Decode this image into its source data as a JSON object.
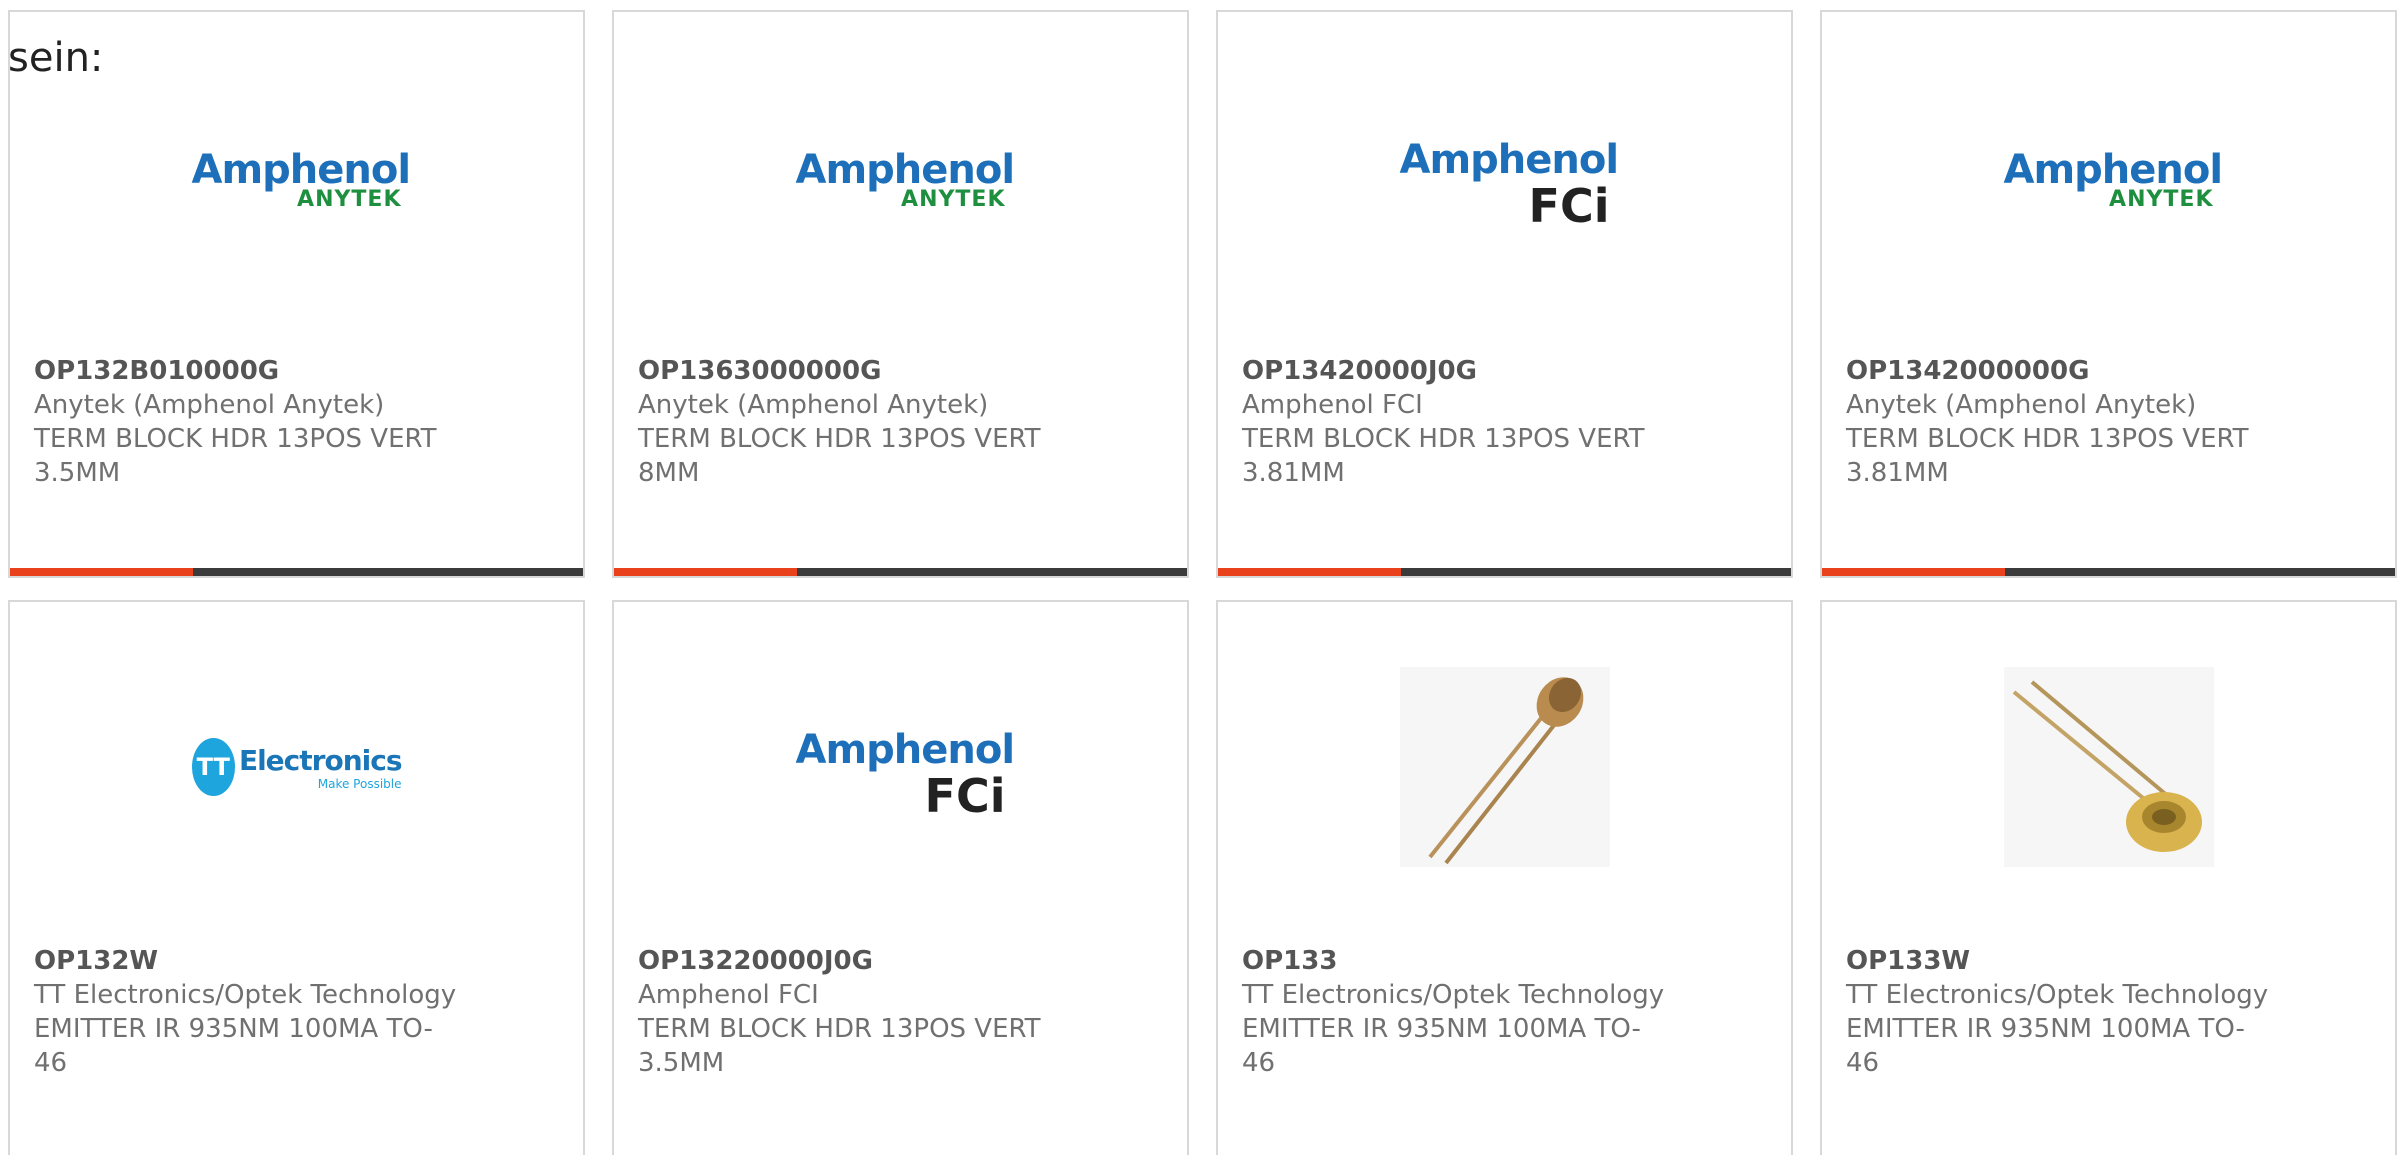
{
  "intro": {
    "text": "sein:"
  },
  "products": [
    {
      "part_number": "OP132B010000G",
      "manufacturer": "Anytek (Amphenol Anytek)",
      "description": "TERM BLOCK HDR 13POS VERT 3.5MM",
      "logo": {
        "type": "amphenol-anytek",
        "brand": "Amphenol",
        "sub": "ANYTEK"
      },
      "progress": 0.32
    },
    {
      "part_number": "OP1363000000G",
      "manufacturer": "Anytek (Amphenol Anytek)",
      "description": "TERM BLOCK HDR 13POS VERT 8MM",
      "logo": {
        "type": "amphenol-anytek",
        "brand": "Amphenol",
        "sub": "ANYTEK"
      },
      "progress": 0.32
    },
    {
      "part_number": "OP13420000J0G",
      "manufacturer": "Amphenol FCI",
      "description": "TERM BLOCK HDR 13POS VERT 3.81MM",
      "logo": {
        "type": "amphenol-fci",
        "brand": "Amphenol",
        "sub": "FCi"
      },
      "progress": 0.32
    },
    {
      "part_number": "OP1342000000G",
      "manufacturer": "Anytek (Amphenol Anytek)",
      "description": "TERM BLOCK HDR 13POS VERT 3.81MM",
      "logo": {
        "type": "amphenol-anytek",
        "brand": "Amphenol",
        "sub": "ANYTEK"
      },
      "progress": 0.32
    },
    {
      "part_number": "OP132W",
      "manufacturer": "TT Electronics/Optek Technology",
      "description": "EMITTER IR 935NM 100MA TO-46",
      "logo": {
        "type": "tt-electronics",
        "brand": "Electronics",
        "sub": "Make Possible",
        "mark": "TT"
      }
    },
    {
      "part_number": "OP13220000J0G",
      "manufacturer": "Amphenol FCI",
      "description": "TERM BLOCK HDR 13POS VERT 3.5MM",
      "logo": {
        "type": "amphenol-fci",
        "brand": "Amphenol",
        "sub": "FCi"
      }
    },
    {
      "part_number": "OP133",
      "manufacturer": "TT Electronics/Optek Technology",
      "description": "EMITTER IR 935NM 100MA TO-46",
      "logo": {
        "type": "photo-led-side"
      }
    },
    {
      "part_number": "OP133W",
      "manufacturer": "TT Electronics/Optek Technology",
      "description": "EMITTER IR 935NM 100MA TO-46",
      "logo": {
        "type": "photo-led-cap"
      }
    }
  ],
  "colors": {
    "progress_fill": "#e8411c",
    "progress_track": "#3b3b3b",
    "card_border": "#d8d8d8",
    "amphenol_blue": "#1c6fb8",
    "anytek_green": "#1e8f3e",
    "tt_blue": "#1ea5dd"
  }
}
